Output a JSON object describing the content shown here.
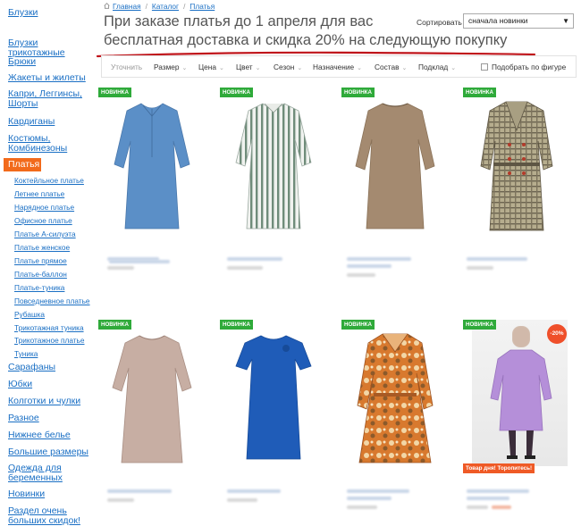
{
  "sidebar": {
    "categories_top": [
      "Блузки",
      "Блузки трикотажные",
      "Брюки",
      "Жакеты и жилеты"
    ],
    "categories_mid": [
      {
        "line1": "Капри, Леггинсы,",
        "line2": "Шорты"
      },
      {
        "line1": "Кардиганы",
        "line2": ""
      },
      {
        "line1": "Костюмы,",
        "line2": "Комбинезоны"
      }
    ],
    "active": "Платья",
    "subcategories": [
      "Коктейльное платье",
      "Летнее платье",
      "Нарядное платье",
      "Офисное платье",
      "Платье А-силуэта",
      "Платье женское",
      "Платье прямое",
      "Платье-баллон",
      "Платье-туника",
      "Повседневное платье",
      "Рубашка",
      "Трикотажная туника",
      "Трикотажное платье",
      "Туника"
    ],
    "categories_bottom": [
      "Сарафаны",
      "Юбки",
      "Колготки и чулки",
      "Разное",
      "Нижнее белье",
      "Большие размеры"
    ],
    "multiline_bottom": [
      {
        "line1": "Одежда для",
        "line2": "беременных"
      },
      {
        "line1": "Новинки",
        "line2": ""
      },
      {
        "line1": "Раздел очень",
        "line2": "больших скидок!"
      }
    ]
  },
  "breadcrumb": [
    "Главная",
    "Каталог",
    "Платья"
  ],
  "headline": {
    "line1": "При заказе платья до 1 апреля для вас",
    "line2": "бесплатная доставка и скидка 20% на следующую покупку"
  },
  "sort": {
    "label": "Сортировать",
    "value": "сначала новинки"
  },
  "filters": {
    "refine": "Уточнить",
    "items": [
      "Размер",
      "Цена",
      "Цвет",
      "Сезон",
      "Назначение",
      "Состав",
      "Подклад"
    ],
    "figure": "Подобрать по фигуре"
  },
  "products": {
    "badge_new": "НОВИНКА",
    "discount": "-20%",
    "deal": "Товар дня! Торопитесь!"
  },
  "colors": {
    "accent": "#f26a1b",
    "link": "#1a6fc4",
    "badge_green": "#2faa3a",
    "underline_red": "#c0151b"
  },
  "icons": {
    "home": "home-icon",
    "dropdown": "chevron-down-icon"
  }
}
